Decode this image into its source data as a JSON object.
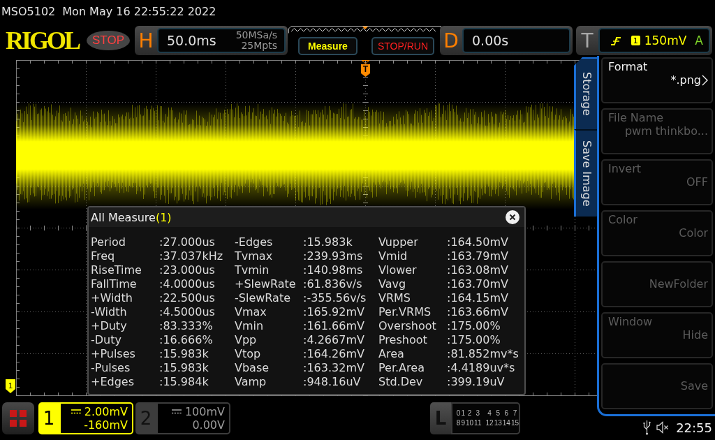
{
  "status_line": {
    "model": "MSO5102",
    "datetime": "Mon May 16 22:55:22 2022"
  },
  "toolbar": {
    "logo": "RIGOL",
    "run_state": "STOP",
    "horizontal": {
      "letter": "H",
      "timebase": "50.0ms",
      "sample_rate": "50MSa/s",
      "memory_depth": "25Mpts"
    },
    "buttons": [
      {
        "label": "Measure",
        "kind": "measure"
      },
      {
        "label": "STOP/RUN",
        "kind": "run_control"
      }
    ],
    "delay": {
      "letter": "D",
      "value": "0.00s"
    },
    "trigger": {
      "letter": "T",
      "source": "1",
      "threshold": "150mV",
      "mode": "A"
    }
  },
  "scope": {
    "trigger_marker": "T",
    "channel_marker": "1",
    "measure_dialog": {
      "title": "All Measure",
      "source": "(1)",
      "columns": [
        [
          {
            "label": "Period",
            "value": ":27.000us"
          },
          {
            "label": "Freq",
            "value": ":37.037kHz"
          },
          {
            "label": "RiseTime",
            "value": ":23.000us"
          },
          {
            "label": "FallTime",
            "value": ":4.0000us"
          },
          {
            "label": "+Width",
            "value": ":22.500us"
          },
          {
            "label": "-Width",
            "value": ":4.5000us"
          },
          {
            "label": "+Duty",
            "value": ":83.333%"
          },
          {
            "label": "-Duty",
            "value": ":16.666%"
          },
          {
            "label": "+Pulses",
            "value": ":15.983k"
          },
          {
            "label": "-Pulses",
            "value": ":15.983k"
          },
          {
            "label": "+Edges",
            "value": ":15.984k"
          }
        ],
        [
          {
            "label": "-Edges",
            "value": ":15.983k"
          },
          {
            "label": "Tvmax",
            "value": ":239.93ms"
          },
          {
            "label": "Tvmin",
            "value": ":140.98ms"
          },
          {
            "label": "+SlewRate",
            "value": ":61.836v/s"
          },
          {
            "label": "-SlewRate",
            "value": ":-355.56v/s"
          },
          {
            "label": "Vmax",
            "value": ":165.92mV"
          },
          {
            "label": "Vmin",
            "value": ":161.66mV"
          },
          {
            "label": "Vpp",
            "value": ":4.2667mV"
          },
          {
            "label": "Vtop",
            "value": ":164.26mV"
          },
          {
            "label": "Vbase",
            "value": ":163.32mV"
          },
          {
            "label": "Vamp",
            "value": ":948.16uV"
          }
        ],
        [
          {
            "label": "Vupper",
            "value": ":164.50mV"
          },
          {
            "label": "Vmid",
            "value": ":163.79mV"
          },
          {
            "label": "Vlower",
            "value": ":163.08mV"
          },
          {
            "label": "Vavg",
            "value": ":163.70mV"
          },
          {
            "label": "VRMS",
            "value": ":164.15mV"
          },
          {
            "label": "Per.VRMS",
            "value": ":163.66mV"
          },
          {
            "label": "Overshoot",
            "value": ":175.00%"
          },
          {
            "label": "Preshoot",
            "value": ":175.00%"
          },
          {
            "label": "Area",
            "value": ":81.852mv*s"
          },
          {
            "label": "Per.Area",
            "value": ":4.4189uv*s"
          },
          {
            "label": "Std.Dev",
            "value": ":399.19uV"
          }
        ]
      ]
    }
  },
  "menu": {
    "tabs": [
      {
        "label": "Storage"
      },
      {
        "label": "Save Image"
      }
    ],
    "items": [
      {
        "label": "Format",
        "value": "*.png",
        "submenu": true,
        "disabled": false
      },
      {
        "label": "File Name",
        "value": "pwm thinkbo...",
        "submenu": false,
        "disabled": true
      },
      {
        "label": "Invert",
        "value": "OFF",
        "submenu": false,
        "disabled": true
      },
      {
        "label": "Color",
        "value": "Color",
        "submenu": false,
        "disabled": true
      },
      {
        "value": "NewFolder",
        "submenu": false,
        "disabled": true
      },
      {
        "label": "Window",
        "value": "Hide",
        "submenu": false,
        "disabled": true
      },
      {
        "value": "Save",
        "submenu": false,
        "disabled": true
      }
    ]
  },
  "bottom_bar": {
    "channels": [
      {
        "number": "1",
        "scale": "2.00mV",
        "offset": "-160mV",
        "on": true
      },
      {
        "number": "2",
        "scale": "100mV",
        "offset": "0.00V",
        "on": false
      }
    ],
    "logic": {
      "letter": "L",
      "rows": [
        [
          "0",
          "1",
          "2",
          "3",
          "4",
          "5",
          "6",
          "7"
        ],
        [
          "8",
          "9",
          "10",
          "11",
          "12",
          "13",
          "14",
          "15"
        ]
      ]
    },
    "time": "22:55"
  }
}
